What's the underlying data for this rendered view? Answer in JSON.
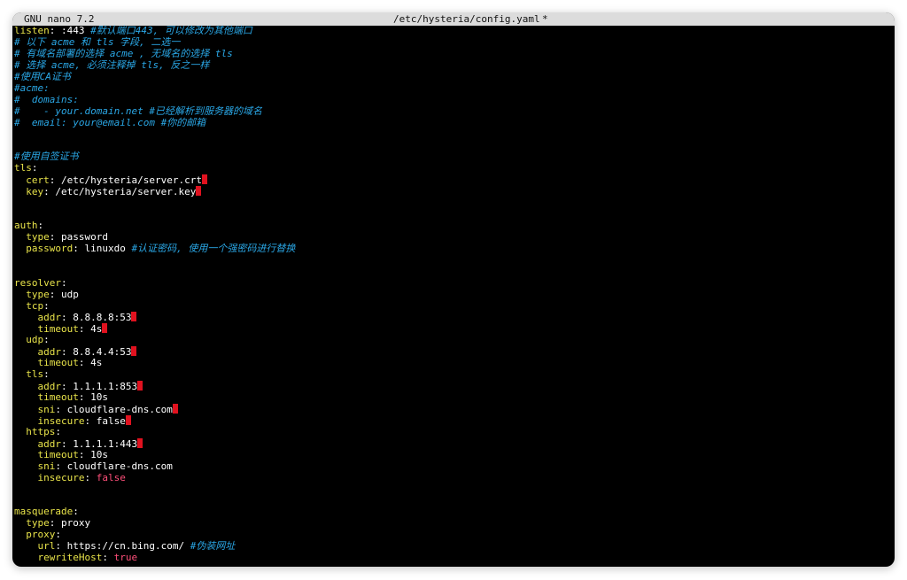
{
  "titlebar": {
    "app": "GNU nano 7.2",
    "file": "/etc/hysteria/config.yaml",
    "modified": "*"
  },
  "lines": [
    {
      "indent": "",
      "key": "listen",
      "value": ":443",
      "comment": "#默认端口443, 可以修改为其他端口"
    },
    {
      "indent": "",
      "comment": "# 以下 acme 和 tls 字段, 二选一"
    },
    {
      "indent": "",
      "comment": "# 有域名部署的选择 acme , 无域名的选择 tls"
    },
    {
      "indent": "",
      "comment": "# 选择 acme, 必须注释掉 tls, 反之一样"
    },
    {
      "indent": "",
      "comment": "#使用CA证书"
    },
    {
      "indent": "",
      "comment": "#acme:"
    },
    {
      "indent": "",
      "comment": "#  domains:"
    },
    {
      "indent": "",
      "comment": "#    - your.domain.net #已经解析到服务器的域名"
    },
    {
      "indent": "",
      "comment": "#  email: your@email.com #你的邮箱"
    },
    {
      "blank": true
    },
    {
      "blank": true
    },
    {
      "indent": "",
      "comment": "#使用自签证书"
    },
    {
      "indent": "",
      "key": "tls"
    },
    {
      "indent": "  ",
      "key": "cert",
      "value": "/etc/hysteria/server.crt",
      "trail": true
    },
    {
      "indent": "  ",
      "key": "key",
      "value": "/etc/hysteria/server.key",
      "trail": true
    },
    {
      "blank": true
    },
    {
      "blank": true
    },
    {
      "indent": "",
      "key": "auth"
    },
    {
      "indent": "  ",
      "key": "type",
      "value": "password"
    },
    {
      "indent": "  ",
      "key": "password",
      "value": "linuxdo",
      "comment": "#认证密码, 使用一个强密码进行替换"
    },
    {
      "blank": true
    },
    {
      "blank": true
    },
    {
      "indent": "",
      "key": "resolver"
    },
    {
      "indent": "  ",
      "key": "type",
      "value": "udp"
    },
    {
      "indent": "  ",
      "key": "tcp"
    },
    {
      "indent": "    ",
      "key": "addr",
      "value": "8.8.8.8:53",
      "trail": true
    },
    {
      "indent": "    ",
      "key": "timeout",
      "value": "4s",
      "trail": true
    },
    {
      "indent": "  ",
      "key": "udp"
    },
    {
      "indent": "    ",
      "key": "addr",
      "value": "8.8.4.4:53",
      "trail": true
    },
    {
      "indent": "    ",
      "key": "timeout",
      "value": "4s"
    },
    {
      "indent": "  ",
      "key": "tls"
    },
    {
      "indent": "    ",
      "key": "addr",
      "value": "1.1.1.1:853",
      "trail": true
    },
    {
      "indent": "    ",
      "key": "timeout",
      "value": "10s"
    },
    {
      "indent": "    ",
      "key": "sni",
      "value": "cloudflare-dns.com",
      "trail": true
    },
    {
      "indent": "    ",
      "key": "insecure",
      "value": "false",
      "trail": true
    },
    {
      "indent": "  ",
      "key": "https"
    },
    {
      "indent": "    ",
      "key": "addr",
      "value": "1.1.1.1:443",
      "trail": true
    },
    {
      "indent": "    ",
      "key": "timeout",
      "value": "10s"
    },
    {
      "indent": "    ",
      "key": "sni",
      "value": "cloudflare-dns.com"
    },
    {
      "indent": "    ",
      "key": "insecure",
      "value": "false",
      "style": "bool"
    },
    {
      "blank": true
    },
    {
      "blank": true
    },
    {
      "indent": "",
      "key": "masquerade"
    },
    {
      "indent": "  ",
      "key": "type",
      "value": "proxy"
    },
    {
      "indent": "  ",
      "key": "proxy"
    },
    {
      "indent": "    ",
      "key": "url",
      "value": "https://cn.bing.com/",
      "comment": "#伪装网址"
    },
    {
      "indent": "    ",
      "key": "rewriteHost",
      "value": "true",
      "style": "bool"
    }
  ],
  "colors": {
    "key": "#e8e34a",
    "comment": "#2aa7e6",
    "bool": "#ff4f7a",
    "trailing_space": "#e0121f",
    "background": "#000000",
    "titlebar": "#dcdcdc"
  }
}
